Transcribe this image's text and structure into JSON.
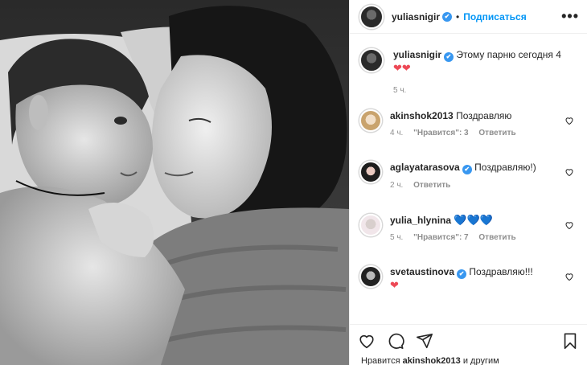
{
  "post": {
    "username": "yuliasnigir",
    "verified_mark": "✔",
    "separator": "•",
    "follow_label": "Подписаться",
    "more_label": "•••"
  },
  "caption": {
    "username": "yuliasnigir",
    "text": "Этому парню сегодня 4",
    "emoji": "❤❤",
    "time": "5 ч."
  },
  "comments": [
    {
      "username": "akinshok2013",
      "text": "Поздравляю",
      "time": "4 ч.",
      "likes": "\"Нравится\": 3",
      "reply": "Ответить"
    },
    {
      "username": "aglayatarasova",
      "text": "Поздравляю!)",
      "time": "2 ч.",
      "reply": "Ответить"
    },
    {
      "username": "yulia_hlynina",
      "text": "💙💙💙",
      "time": "5 ч.",
      "likes": "\"Нравится\": 7",
      "reply": "Ответить"
    },
    {
      "username": "svetaustinova",
      "text": "Поздравляю!!!",
      "emoji": "❤",
      "time": "",
      "reply": ""
    }
  ],
  "likes_line": {
    "prefix": "Нравится",
    "user": "akinshok2013",
    "suffix": "и другим"
  },
  "icons": {
    "like": "heart-outline-icon",
    "comment": "comment-icon",
    "share": "paper-plane-icon",
    "save": "bookmark-icon",
    "verified": "verified-badge-icon",
    "comment_like": "small-heart-icon"
  },
  "colors": {
    "accent": "#0095f6",
    "verified": "#3897f0",
    "heart": "#ed4956",
    "meta": "#8e8e8e"
  }
}
